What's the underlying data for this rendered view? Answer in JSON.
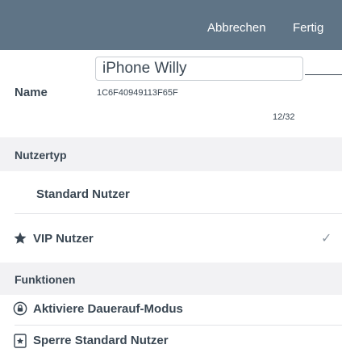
{
  "topbar": {
    "cancel_label": "Abbrechen",
    "done_label": "Fertig"
  },
  "name_section": {
    "label": "Name",
    "value": "iPhone Willy",
    "device_id": "1C6F40949113F65F",
    "char_count": "12/32"
  },
  "user_type": {
    "header": "Nutzertyp",
    "options": [
      {
        "label": "Standard Nutzer",
        "selected": false
      },
      {
        "label": "VIP Nutzer",
        "selected": true,
        "icon": "star-icon"
      }
    ],
    "check_glyph": "✓"
  },
  "functions": {
    "header": "Funktionen",
    "items": [
      {
        "label": "Aktiviere Dauerauf-Modus",
        "icon": "lock-circle-icon"
      },
      {
        "label": "Sperre Standard Nutzer",
        "icon": "lock-square-icon"
      }
    ]
  },
  "colors": {
    "topbar": "#5f7486",
    "text": "#3a4753",
    "section_bg": "#f2f2f4"
  }
}
